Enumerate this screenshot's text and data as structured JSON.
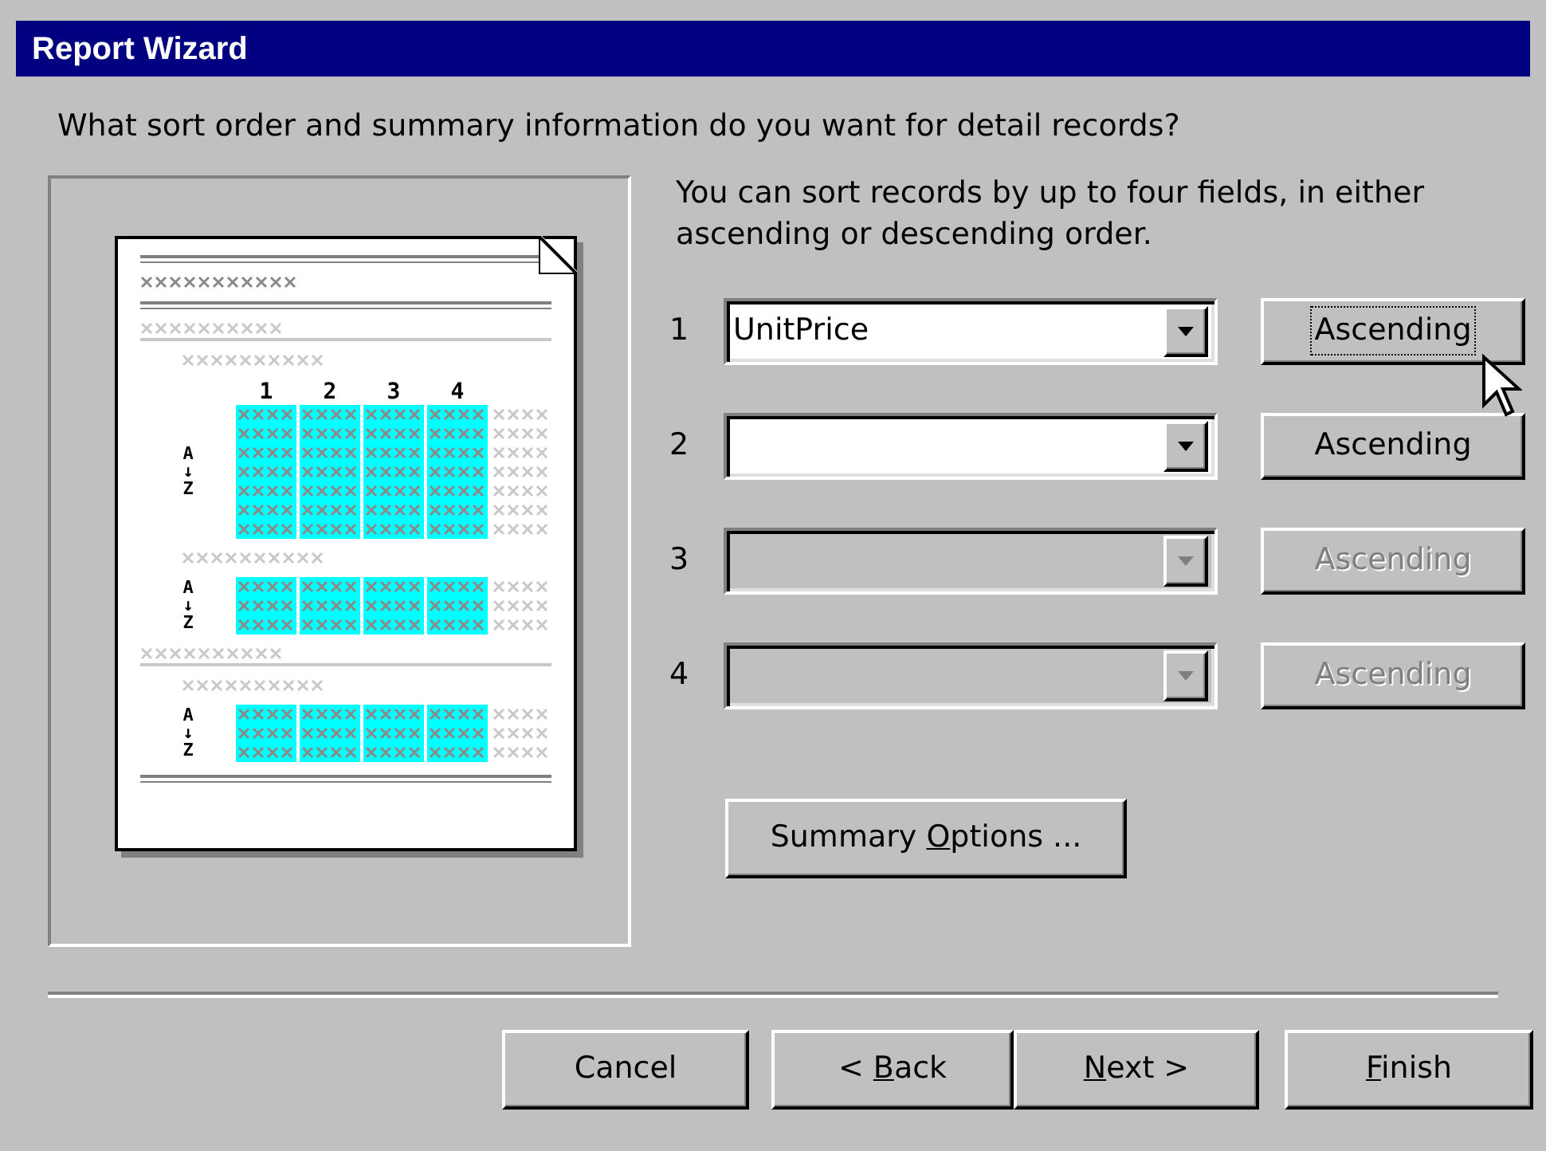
{
  "window": {
    "title": "Report Wizard"
  },
  "question": "What sort order and summary information do you want for detail records?",
  "preview": {
    "column_numbers": [
      "1",
      "2",
      "3",
      "4"
    ],
    "groups": [
      {
        "sort_top": "A",
        "sort_arrow": "↓",
        "sort_bottom": "Z"
      },
      {
        "sort_top": "A",
        "sort_arrow": "↓",
        "sort_bottom": "Z"
      },
      {
        "sort_top": "A",
        "sort_arrow": "↓",
        "sort_bottom": "Z"
      }
    ]
  },
  "instructions": "You can sort records by up to four fields, in either ascending or descending order.",
  "sort_rows": [
    {
      "number": "1",
      "value": "UnitPrice",
      "enabled": true,
      "sort_button": "Ascending",
      "focused": true
    },
    {
      "number": "2",
      "enabled": true,
      "sort_button": "Ascending",
      "focused": false
    },
    {
      "number": "3",
      "enabled": false,
      "sort_button": "Ascending",
      "focused": false
    },
    {
      "number": "4",
      "enabled": false,
      "sort_button": "Ascending",
      "focused": false
    }
  ],
  "summary_button": {
    "before": "Summary ",
    "key": "O",
    "after": "ptions ..."
  },
  "buttons": [
    {
      "before": "Cancel"
    },
    {
      "before": "< ",
      "key": "B",
      "after": "ack"
    },
    {
      "key": "N",
      "after": "ext >"
    },
    {
      "key": "F",
      "after": "inish"
    }
  ]
}
